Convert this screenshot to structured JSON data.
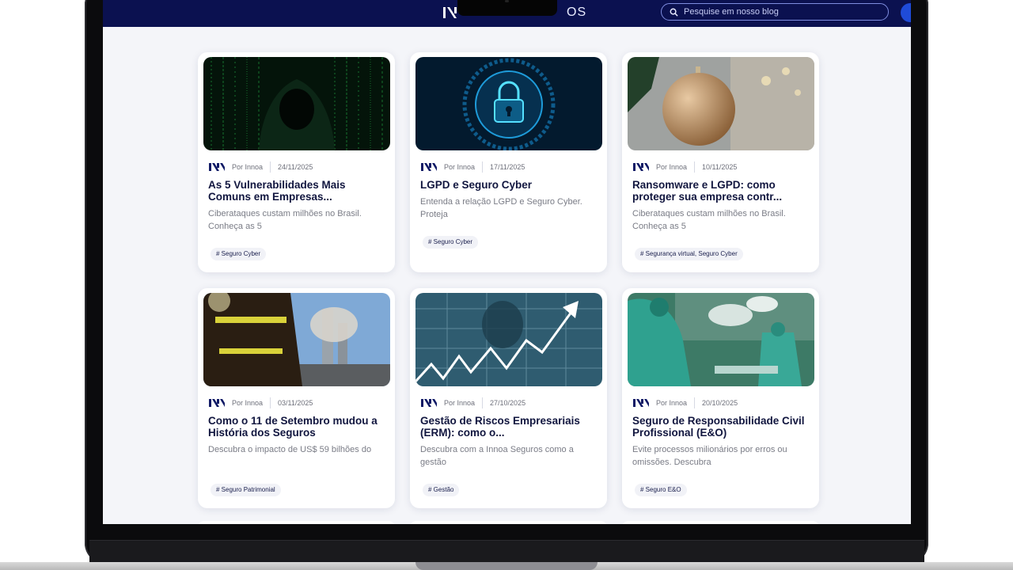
{
  "app": {
    "brand_text": "OS",
    "search_placeholder": "Pesquise em nosso blog"
  },
  "cards": [
    {
      "author": "Por Innoa",
      "date": "24/11/2025",
      "title": "As 5 Vulnerabilidades Mais Comuns em Empresas...",
      "excerpt": "Ciberataques custam milhões no Brasil. Conheça as 5",
      "tag": "# Seguro Cyber",
      "image": "hacker-hood"
    },
    {
      "author": "Por Innoa",
      "date": "17/11/2025",
      "title": "LGPD e Seguro Cyber",
      "excerpt": "Entenda a relação LGPD e Seguro Cyber. Proteja",
      "tag": "# Seguro Cyber",
      "image": "padlock"
    },
    {
      "author": "Por Innoa",
      "date": "10/11/2025",
      "title": "Ransomware e LGPD: como proteger sua empresa contr...",
      "excerpt": "Ciberataques custam milhões no Brasil. Conheça as 5",
      "tag": "# Segurança virtual, Seguro Cyber",
      "image": "ornament"
    },
    {
      "author": "Por Innoa",
      "date": "03/11/2025",
      "title": "Como o 11 de Setembro mudou a História dos Seguros",
      "excerpt": "Descubra o impacto de US$ 59 bilhões do",
      "tag": "# Seguro Patrimonial",
      "image": "firefighter"
    },
    {
      "author": "Por Innoa",
      "date": "27/10/2025",
      "title": "Gestão de Riscos Empresariais (ERM): como o...",
      "excerpt": "Descubra com a Innoa Seguros como a gestão",
      "tag": "# Gestão",
      "image": "graph"
    },
    {
      "author": "Por Innoa",
      "date": "20/10/2025",
      "title": "Seguro de Responsabilidade Civil Profissional (E&O)",
      "excerpt": "Evite processos milionários por erros ou omissões. Descubra",
      "tag": "# Seguro E&O",
      "image": "surgery"
    }
  ]
}
